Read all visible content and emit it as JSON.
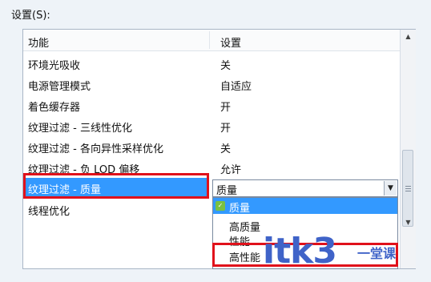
{
  "settings_label": "设置(S):",
  "table": {
    "header": {
      "feature": "功能",
      "setting": "设置"
    },
    "rows": [
      {
        "name": "环境光吸收",
        "value": "关"
      },
      {
        "name": "电源管理模式",
        "value": "自适应"
      },
      {
        "name": "着色缓存器",
        "value": "开"
      },
      {
        "name": "纹理过滤 - 三线性优化",
        "value": "开"
      },
      {
        "name": "纹理过滤 - 各向异性采样优化",
        "value": "关"
      },
      {
        "name": "纹理过滤 - 负 LOD 偏移",
        "value": "允许"
      },
      {
        "name": "纹理过滤 - 质量",
        "value": ""
      },
      {
        "name": "线程优化",
        "value": ""
      }
    ]
  },
  "combo": {
    "value": "质量",
    "options": [
      "质量",
      "高质量",
      "性能",
      "高性能"
    ]
  },
  "watermark": {
    "text": "itk3",
    "suffix": "一堂课"
  }
}
